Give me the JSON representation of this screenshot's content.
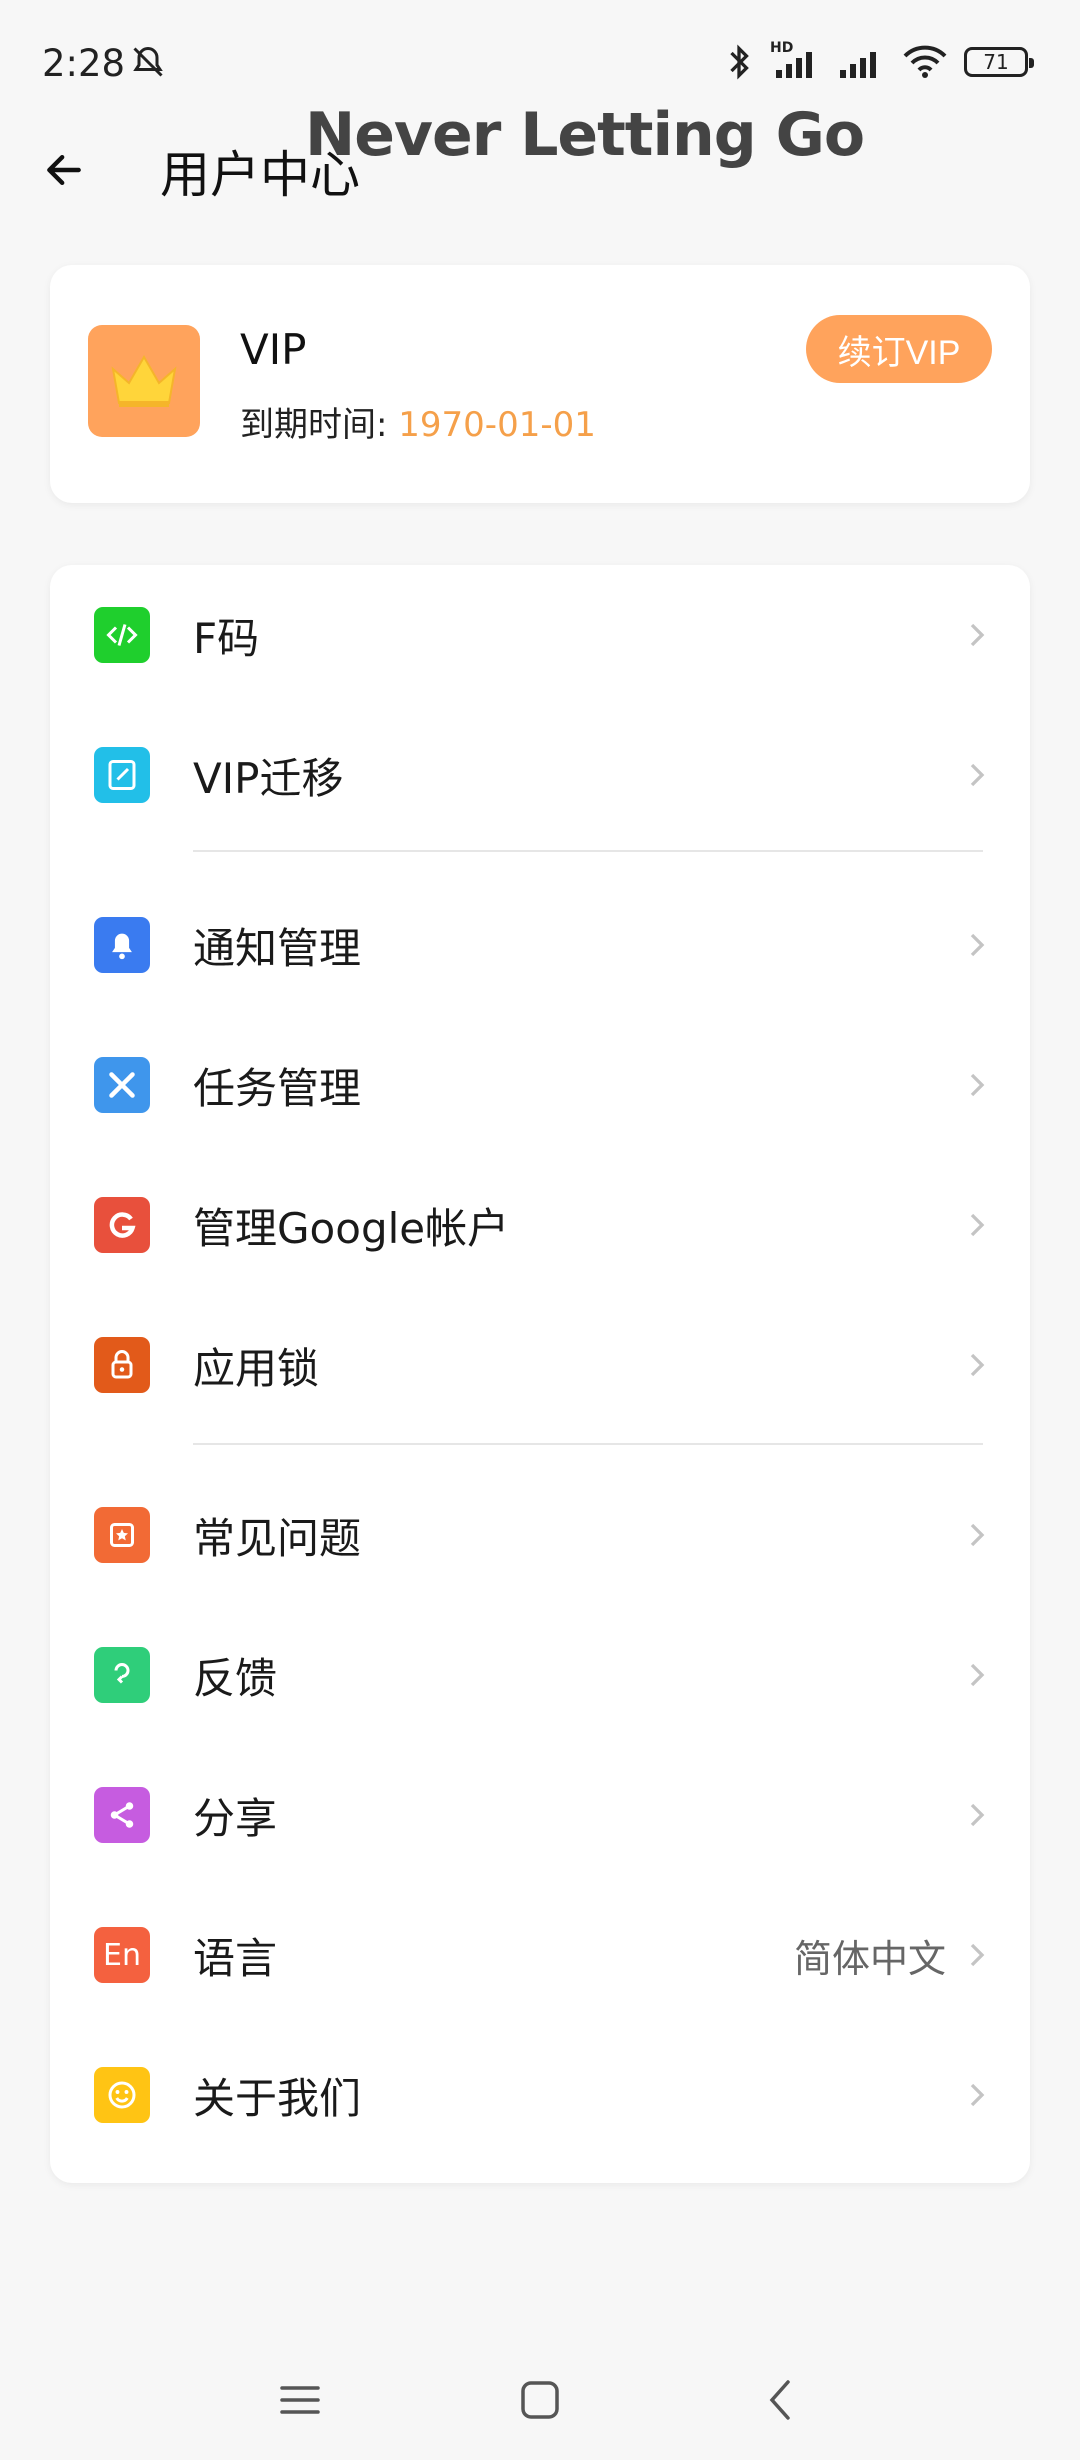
{
  "status_bar": {
    "time": "2:28",
    "network_label": "HD",
    "battery": "71"
  },
  "header": {
    "title": "用户中心",
    "overlay_title": "Never Letting Go"
  },
  "vip_card": {
    "name": "VIP",
    "expire_label": "到期时间:",
    "expire_date": "1970-01-01",
    "renew_label": "续订VIP"
  },
  "menu": {
    "items": [
      {
        "label": "F码",
        "icon": "code-icon",
        "color": "#1fcf2d"
      },
      {
        "label": "VIP迁移",
        "icon": "edit-note-icon",
        "color": "#22bfe8"
      },
      {
        "label": "通知管理",
        "icon": "bell-icon",
        "color": "#3a7bf0"
      },
      {
        "label": "任务管理",
        "icon": "tools-icon",
        "color": "#3f96ec"
      },
      {
        "label": "管理Google帐户",
        "icon": "google-icon",
        "color": "#e8503c"
      },
      {
        "label": "应用锁",
        "icon": "lock-icon",
        "color": "#e25a1a"
      },
      {
        "label": "常见问题",
        "icon": "faq-icon",
        "color": "#f26a35"
      },
      {
        "label": "反馈",
        "icon": "feedback-icon",
        "color": "#2fce7a"
      },
      {
        "label": "分享",
        "icon": "share-icon",
        "color": "#c65ce0"
      },
      {
        "label": "语言",
        "icon": "language-icon",
        "color": "#f4613f",
        "value": "简体中文"
      },
      {
        "label": "关于我们",
        "icon": "smile-icon",
        "color": "#ffc414"
      }
    ]
  }
}
